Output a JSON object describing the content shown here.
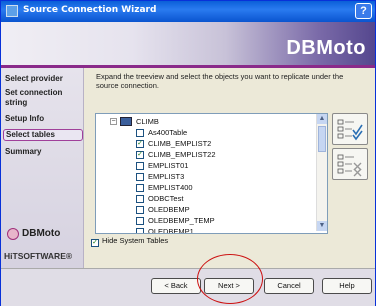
{
  "window": {
    "title": "Source Connection Wizard",
    "help_button": "?"
  },
  "banner": {
    "brand": "DBMoto"
  },
  "sidebar": {
    "items": [
      {
        "label": "Select provider"
      },
      {
        "label": "Set connection string"
      },
      {
        "label": "Setup Info"
      },
      {
        "label": "Select tables"
      },
      {
        "label": "Summary"
      }
    ],
    "logo_text": "DBMoto",
    "company": "HiTSOFTWARE®"
  },
  "content": {
    "instructions": "Expand the treeview and select the objects you want to replicate under the source connection.",
    "tree": {
      "root": "CLIMB",
      "items": [
        {
          "label": "As400Table",
          "checked": false
        },
        {
          "label": "CLIMB_EMPLIST2",
          "checked": true
        },
        {
          "label": "CLIMB_EMPLIST22",
          "checked": true
        },
        {
          "label": "EMPLIST01",
          "checked": false
        },
        {
          "label": "EMPLIST3",
          "checked": false
        },
        {
          "label": "EMPLIST400",
          "checked": false
        },
        {
          "label": "ODBCTest",
          "checked": false
        },
        {
          "label": "OLEDBEMP",
          "checked": false
        },
        {
          "label": "OLEDBEMP_TEMP",
          "checked": false
        },
        {
          "label": "OLEDBEMP1",
          "checked": false
        }
      ]
    },
    "hide_system_tables": {
      "label": "Hide System Tables",
      "checked": true
    }
  },
  "buttons": {
    "back": "< Back",
    "next": "Next >",
    "cancel": "Cancel",
    "help": "Help"
  },
  "colors": {
    "title_bar": "#0a5fd8",
    "banner_accent": "#55478e",
    "annotation": "#cc1111"
  }
}
